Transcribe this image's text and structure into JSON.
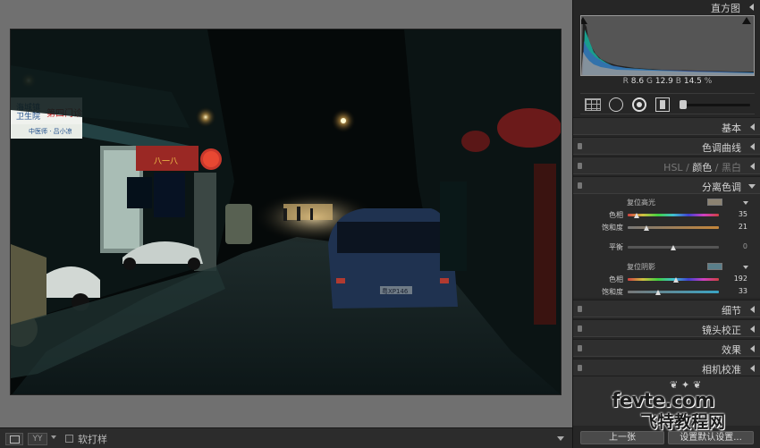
{
  "histogram": {
    "title": "直方图",
    "readout": {
      "r_label": "R",
      "r": "8.6",
      "g_label": "G",
      "g": "12.9",
      "b_label": "B",
      "b": "14.5",
      "unit": "%"
    }
  },
  "tools": [
    "grid-overlay-icon",
    "crop-icon",
    "spot-removal-icon",
    "red-eye-icon",
    "adjustment-brush-icon"
  ],
  "sections": {
    "basic": "基本",
    "tone_curve": "色调曲线",
    "hsl": {
      "hsl": "HSL",
      "sep1": "/",
      "color": "颜色",
      "sep2": "/",
      "bw": "黑白"
    },
    "split_toning": "分离色调",
    "detail": "细节",
    "lens": "镜头校正",
    "effects": "效果",
    "calibration": "相机校准"
  },
  "split_toning": {
    "highlights_title": "复位高光",
    "highlights_swatch": "#8c8372",
    "hue_label": "色相",
    "saturation_label": "饱和度",
    "highlight_hue": 35,
    "highlight_saturation": 21,
    "balance_label": "平衡",
    "balance": 0,
    "shadows_title": "复位阴影",
    "shadows_swatch": "#5a7f8a",
    "shadow_hue": 192,
    "shadow_saturation": 33
  },
  "toolbar": {
    "compare_label": "YY",
    "softproof_label": "软打样"
  },
  "buttons": {
    "prev": "上一张",
    "reset": "设置默认设置..."
  },
  "watermark": {
    "line1": "fevte.com",
    "line2": "飞特教程网"
  },
  "photo": {
    "sign_top": "海城镇\n卫生院",
    "sign_right": "第四门诊",
    "sign_bottom": "中医师 · 吕小凉",
    "plate": "粤XP146"
  }
}
